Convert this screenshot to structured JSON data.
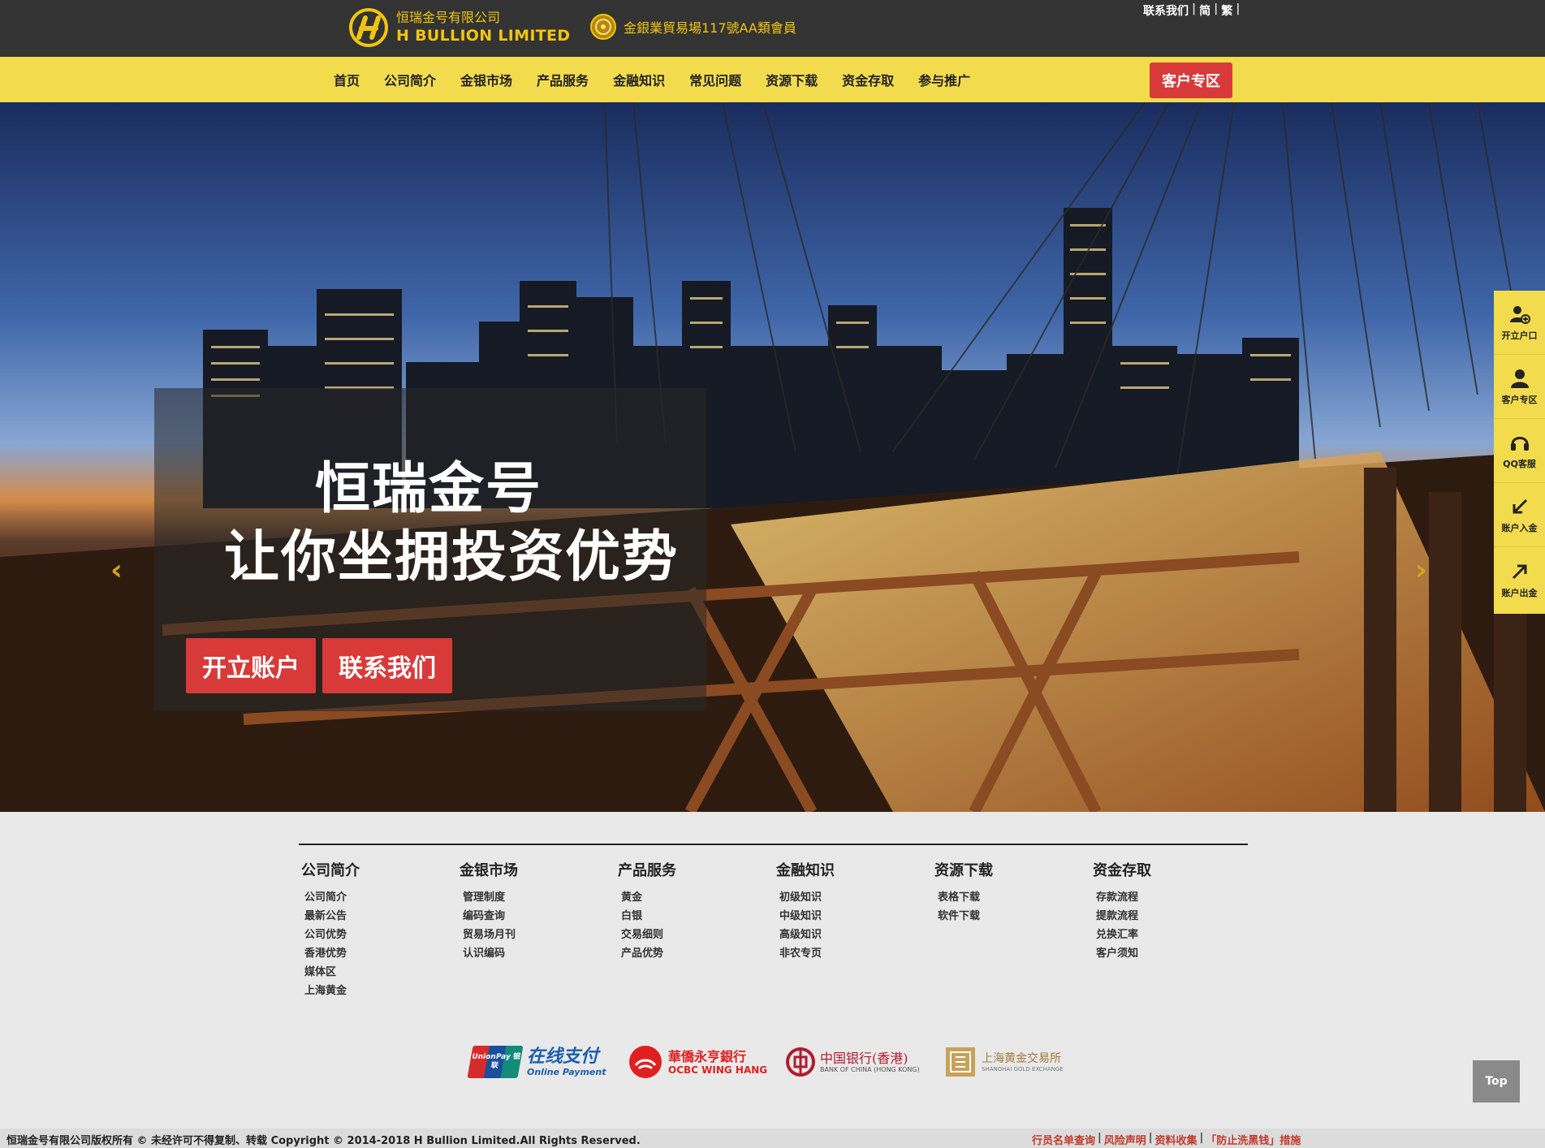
{
  "header": {
    "logo_cn": "恒瑞金号有限公司",
    "logo_en": "H BULLION LIMITED",
    "member_text": "金銀業貿易場117號AA類會員",
    "links": [
      "联系我们",
      "简",
      "繁"
    ]
  },
  "nav": {
    "items": [
      "首页",
      "公司简介",
      "金银市场",
      "产品服务",
      "金融知识",
      "常见问题",
      "资源下载",
      "资金存取",
      "参与推广"
    ],
    "client_button": "客户专区"
  },
  "hero": {
    "title_line1": "恒瑞金号",
    "title_line2": "让你坐拥投资优势",
    "btn_open": "开立账户",
    "btn_contact": "联系我们",
    "prev_arrow": "‹",
    "next_arrow": "›",
    "slide_count": 2,
    "active_slide": 1
  },
  "sidebar": {
    "items": [
      {
        "label": "开立户口",
        "icon": "add-user-icon"
      },
      {
        "label": "客户专区",
        "icon": "user-icon"
      },
      {
        "label": "QQ客服",
        "icon": "headset-icon"
      },
      {
        "label": "账户入金",
        "icon": "arrow-down-left-icon"
      },
      {
        "label": "账户出金",
        "icon": "arrow-up-right-icon"
      }
    ]
  },
  "footer": {
    "columns": [
      {
        "title": "公司简介",
        "links": [
          "公司简介",
          "最新公告",
          "公司优势",
          "香港优势",
          "媒体区",
          "上海黄金"
        ]
      },
      {
        "title": "金银市场",
        "links": [
          "管理制度",
          "编码查询",
          "贸易场月刊",
          "认识编码"
        ]
      },
      {
        "title": "产品服务",
        "links": [
          "黄金",
          "白银",
          "交易细则",
          "产品优势"
        ]
      },
      {
        "title": "金融知识",
        "links": [
          "初级知识",
          "中级知识",
          "高级知识",
          "非农专页"
        ]
      },
      {
        "title": "资源下载",
        "links": [
          "表格下载",
          "软件下载"
        ]
      },
      {
        "title": "资金存取",
        "links": [
          "存款流程",
          "提款流程",
          "兑换汇率",
          "客户须知"
        ]
      }
    ],
    "partners": {
      "unionpay_badge": "UnionPay 银联",
      "unionpay_cn": "在线支付",
      "unionpay_en": "Online Payment",
      "ocbc_cn": "華僑永亨銀行",
      "ocbc_en": "OCBC WING HANG",
      "boc_cn": "中国银行(香港)",
      "boc_en": "BANK OF CHINA (HONG KONG)",
      "sge_cn": "上海黄金交易所",
      "sge_en": "SHANGHAI GOLD EXCHANGE"
    },
    "top_button": "Top",
    "copyright": "恒瑞金号有限公司版权所有 © 未经许可不得复制、转载 Copyright © 2014-2018 H Bullion Limited.All Rights Reserved.",
    "right_links": [
      "行员名单查询",
      "风险声明",
      "资料收集",
      "「防止洗黑钱」措施"
    ]
  },
  "colors": {
    "topbar": "#333333",
    "nav": "#f2dc4e",
    "accent_red": "#d83a3a",
    "gold": "#f1c40f"
  }
}
